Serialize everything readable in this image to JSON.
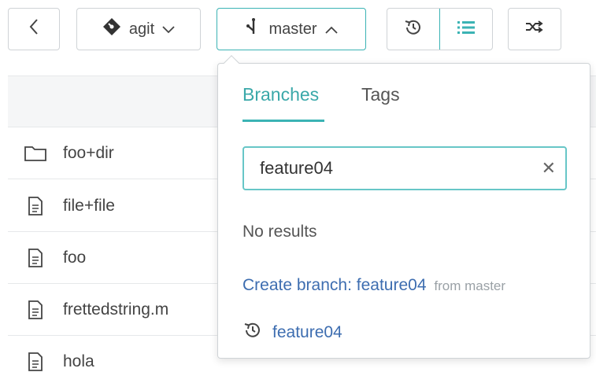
{
  "toolbar": {
    "repo_label": "agit",
    "branch_label": "master",
    "icons": {
      "back": "chevron-left-icon",
      "repo": "diamond-icon",
      "branch": "git-branch-icon",
      "history": "history-icon",
      "list": "list-icon",
      "compare": "shuffle-icon"
    }
  },
  "files": [
    {
      "name": "foo+dir",
      "type": "folder"
    },
    {
      "name": "file+file",
      "type": "file"
    },
    {
      "name": "foo",
      "type": "file"
    },
    {
      "name": "frettedstring.m",
      "type": "file"
    },
    {
      "name": "hola",
      "type": "file"
    }
  ],
  "branch_popover": {
    "tabs": [
      "Branches",
      "Tags"
    ],
    "active_tab": "Branches",
    "search_value": "feature04",
    "no_results": "No results",
    "create_prefix": "Create branch:",
    "create_name": "feature04",
    "create_from": "from master",
    "recent_item": "feature04"
  },
  "colors": {
    "accent": "#3bb3b4",
    "link": "#3d6db0"
  }
}
